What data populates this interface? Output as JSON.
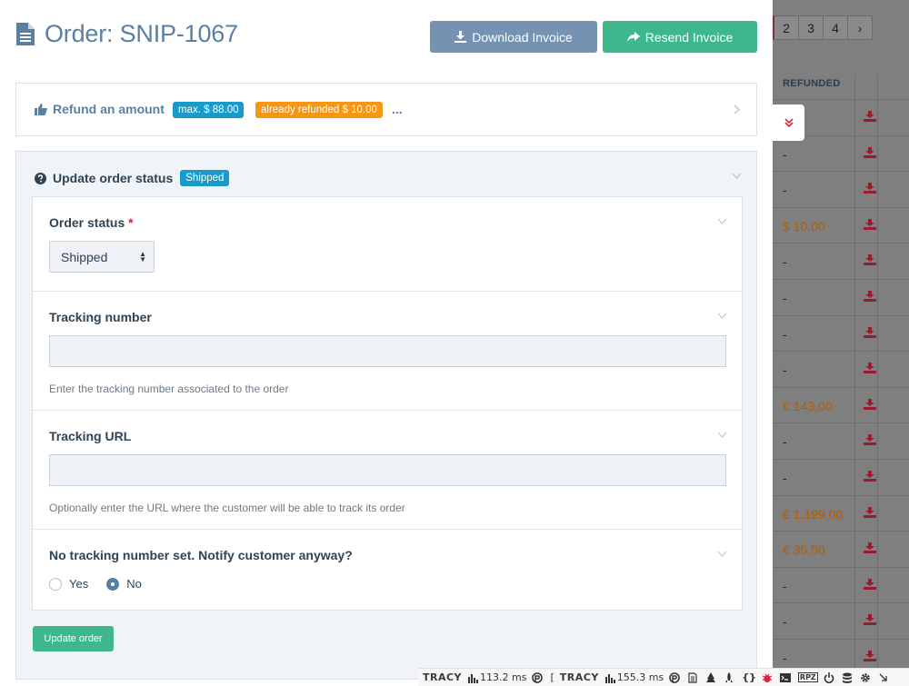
{
  "header": {
    "title": "Order: SNIP-1067",
    "download_label": "Download Invoice",
    "resend_label": "Resend Invoice"
  },
  "refund": {
    "label": "Refund an amount",
    "max_badge": "max. $ 88.00",
    "refunded_badge": "already refunded $ 10.00",
    "more": "..."
  },
  "status": {
    "label": "Update order status",
    "badge": "Shipped",
    "order_status": {
      "label": "Order status",
      "required": "*",
      "selected": "Shipped"
    },
    "tracking_number": {
      "label": "Tracking number",
      "value": "",
      "help": "Enter the tracking number associated to the order"
    },
    "tracking_url": {
      "label": "Tracking URL",
      "value": "",
      "help": "Optionally enter the URL where the customer will be able to track its order"
    },
    "notify": {
      "label": "No tracking number set. Notify customer anyway?",
      "options": [
        "Yes",
        "No"
      ],
      "selected": "No"
    },
    "submit_label": "Update order"
  },
  "background": {
    "pagination": [
      "2",
      "3",
      "4",
      "›"
    ],
    "column_header": "REFUNDED",
    "rows": [
      "",
      "-",
      "-",
      "$ 10.00",
      "-",
      "-",
      "-",
      "-",
      "€ 143,00",
      "-",
      "-",
      "€ 1.199,00",
      "€ 35,50",
      "-",
      "-",
      "-"
    ]
  },
  "tracy": {
    "logo1": "TRACY",
    "time1": "113.2 ms",
    "logo2": "TRACY",
    "time2": "155.3 ms",
    "rpz": "RPZ",
    "braces": "{}"
  },
  "colors": {
    "primary": "#5a7fa3",
    "success": "#3eb78f",
    "info": "#189acb",
    "warning": "#f59714",
    "danger": "#d9233a"
  }
}
